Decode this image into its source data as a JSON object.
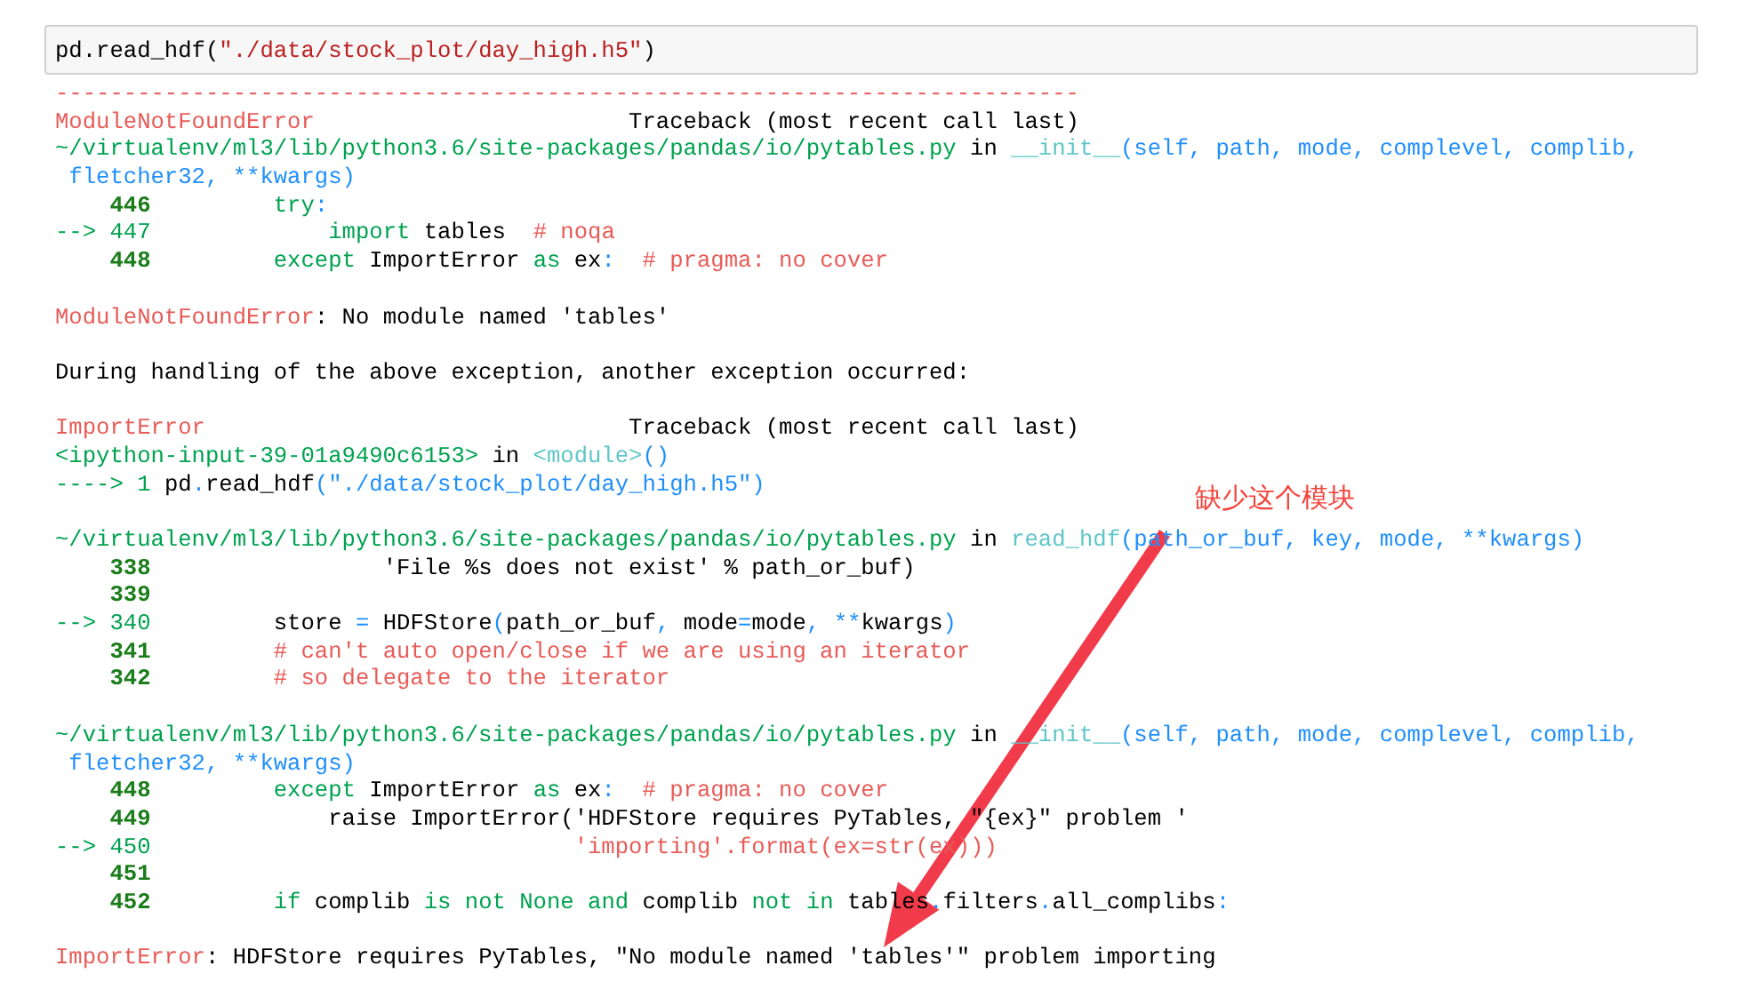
{
  "input_cell": {
    "segments": [
      {
        "text": "pd.read_hdf(",
        "kind": "plain"
      },
      {
        "text": "\"./data/stock_plot/day_high.h5\"",
        "kind": "string"
      },
      {
        "text": ")",
        "kind": "plain"
      }
    ]
  },
  "output": {
    "blocks": [
      [
        {
          "segments": [
            {
              "text": "---------------------------------------------------------------------------",
              "kind": "red"
            }
          ]
        },
        {
          "segments": [
            {
              "text": "ModuleNotFoundError",
              "kind": "red"
            },
            {
              "text": "                       Traceback (most recent call last)",
              "kind": "plain"
            }
          ]
        },
        {
          "segments": [
            {
              "text": "~/virtualenv/ml3/lib/python3.6/site-packages/pandas/io/pytables.py",
              "kind": "green"
            },
            {
              "text": " in ",
              "kind": "plain"
            },
            {
              "text": "__init__",
              "kind": "cyan"
            },
            {
              "text": "(self, path, mode, complevel, complib,",
              "kind": "blue"
            }
          ]
        },
        {
          "segments": [
            {
              "text": " fletcher32, **kwargs)",
              "kind": "blue"
            }
          ]
        },
        {
          "segments": [
            {
              "text": "    446",
              "kind": "lineno"
            },
            {
              "text": "         try",
              "kind": "green"
            },
            {
              "text": ":",
              "kind": "blue"
            }
          ]
        },
        {
          "segments": [
            {
              "text": "--> 447",
              "kind": "green"
            },
            {
              "text": "             import",
              "kind": "green"
            },
            {
              "text": " tables  ",
              "kind": "plain"
            },
            {
              "text": "# noqa",
              "kind": "red"
            }
          ]
        },
        {
          "segments": [
            {
              "text": "    448",
              "kind": "lineno"
            },
            {
              "text": "         except",
              "kind": "green"
            },
            {
              "text": " ImportError ",
              "kind": "plain"
            },
            {
              "text": "as",
              "kind": "green"
            },
            {
              "text": " ex",
              "kind": "plain"
            },
            {
              "text": ":",
              "kind": "blue"
            },
            {
              "text": "  # pragma: no cover",
              "kind": "red"
            }
          ]
        }
      ],
      [
        {
          "segments": [
            {
              "text": "ModuleNotFoundError",
              "kind": "red"
            },
            {
              "text": ": No module named 'tables'",
              "kind": "plain"
            }
          ]
        }
      ],
      [
        {
          "segments": [
            {
              "text": "During handling of the above exception, another exception occurred:",
              "kind": "plain"
            }
          ]
        }
      ],
      [
        {
          "segments": [
            {
              "text": "ImportError",
              "kind": "red"
            },
            {
              "text": "                               Traceback (most recent call last)",
              "kind": "plain"
            }
          ]
        },
        {
          "segments": [
            {
              "text": "<ipython-input-39-01a9490c6153>",
              "kind": "green"
            },
            {
              "text": " in ",
              "kind": "plain"
            },
            {
              "text": "<module>",
              "kind": "cyan"
            },
            {
              "text": "()",
              "kind": "blue"
            }
          ]
        },
        {
          "segments": [
            {
              "text": "----> 1",
              "kind": "green"
            },
            {
              "text": " pd",
              "kind": "plain"
            },
            {
              "text": ".",
              "kind": "blue"
            },
            {
              "text": "read_hdf",
              "kind": "plain"
            },
            {
              "text": "(\"./data/stock_plot/day_high.h5\")",
              "kind": "blue"
            }
          ]
        }
      ],
      [
        {
          "segments": [
            {
              "text": "~/virtualenv/ml3/lib/python3.6/site-packages/pandas/io/pytables.py",
              "kind": "green"
            },
            {
              "text": " in ",
              "kind": "plain"
            },
            {
              "text": "read_hdf",
              "kind": "cyan"
            },
            {
              "text": "(path_or_buf, key, mode, **kwargs)",
              "kind": "blue"
            }
          ]
        },
        {
          "segments": [
            {
              "text": "    338",
              "kind": "lineno"
            },
            {
              "text": "                 'File %s does not exist' % path_or_buf)",
              "kind": "plain"
            }
          ]
        },
        {
          "segments": [
            {
              "text": "    339",
              "kind": "lineno"
            }
          ]
        },
        {
          "segments": [
            {
              "text": "--> 340",
              "kind": "green"
            },
            {
              "text": "         store ",
              "kind": "plain"
            },
            {
              "text": "=",
              "kind": "blue"
            },
            {
              "text": " HDFStore",
              "kind": "plain"
            },
            {
              "text": "(",
              "kind": "blue"
            },
            {
              "text": "path_or_buf",
              "kind": "plain"
            },
            {
              "text": ",",
              "kind": "blue"
            },
            {
              "text": " mode",
              "kind": "plain"
            },
            {
              "text": "=",
              "kind": "blue"
            },
            {
              "text": "mode",
              "kind": "plain"
            },
            {
              "text": ",",
              "kind": "blue"
            },
            {
              "text": " **",
              "kind": "blue"
            },
            {
              "text": "kwargs",
              "kind": "plain"
            },
            {
              "text": ")",
              "kind": "blue"
            }
          ]
        },
        {
          "segments": [
            {
              "text": "    341",
              "kind": "lineno"
            },
            {
              "text": "         # can't auto open/close if we are using an iterator",
              "kind": "red"
            }
          ]
        },
        {
          "segments": [
            {
              "text": "    342",
              "kind": "lineno"
            },
            {
              "text": "         # so delegate to the iterator",
              "kind": "red"
            }
          ]
        }
      ],
      [
        {
          "segments": [
            {
              "text": "~/virtualenv/ml3/lib/python3.6/site-packages/pandas/io/pytables.py",
              "kind": "green"
            },
            {
              "text": " in ",
              "kind": "plain"
            },
            {
              "text": "__init__",
              "kind": "cyan"
            },
            {
              "text": "(self, path, mode, complevel, complib,",
              "kind": "blue"
            }
          ]
        },
        {
          "segments": [
            {
              "text": " fletcher32, **kwargs)",
              "kind": "blue"
            }
          ]
        },
        {
          "segments": [
            {
              "text": "    448",
              "kind": "lineno"
            },
            {
              "text": "         except",
              "kind": "green"
            },
            {
              "text": " ImportError ",
              "kind": "plain"
            },
            {
              "text": "as",
              "kind": "green"
            },
            {
              "text": " ex",
              "kind": "plain"
            },
            {
              "text": ":",
              "kind": "blue"
            },
            {
              "text": "  # pragma: no cover",
              "kind": "red"
            }
          ]
        },
        {
          "segments": [
            {
              "text": "    449",
              "kind": "lineno"
            },
            {
              "text": "             raise ImportError('HDFStore requires PyTables, \"{ex}\" problem '",
              "kind": "plain"
            }
          ]
        },
        {
          "segments": [
            {
              "text": "--> 450",
              "kind": "green"
            },
            {
              "text": "                               'importing'.format(ex=str(ex)))",
              "kind": "red"
            }
          ]
        },
        {
          "segments": [
            {
              "text": "    451",
              "kind": "lineno"
            }
          ]
        },
        {
          "segments": [
            {
              "text": "    452",
              "kind": "lineno"
            },
            {
              "text": "         if",
              "kind": "green"
            },
            {
              "text": " complib ",
              "kind": "plain"
            },
            {
              "text": "is not None and",
              "kind": "green"
            },
            {
              "text": " complib ",
              "kind": "plain"
            },
            {
              "text": "not in",
              "kind": "green"
            },
            {
              "text": " tables",
              "kind": "plain"
            },
            {
              "text": ".",
              "kind": "blue"
            },
            {
              "text": "filters",
              "kind": "plain"
            },
            {
              "text": ".",
              "kind": "blue"
            },
            {
              "text": "all_complibs",
              "kind": "plain"
            },
            {
              "text": ":",
              "kind": "blue"
            }
          ]
        }
      ],
      [
        {
          "segments": [
            {
              "text": "ImportError",
              "kind": "red"
            },
            {
              "text": ": HDFStore requires PyTables, \"No module named 'tables'\" problem importing",
              "kind": "plain"
            }
          ]
        }
      ]
    ]
  },
  "annotation": {
    "label": "缺少这个模块"
  }
}
